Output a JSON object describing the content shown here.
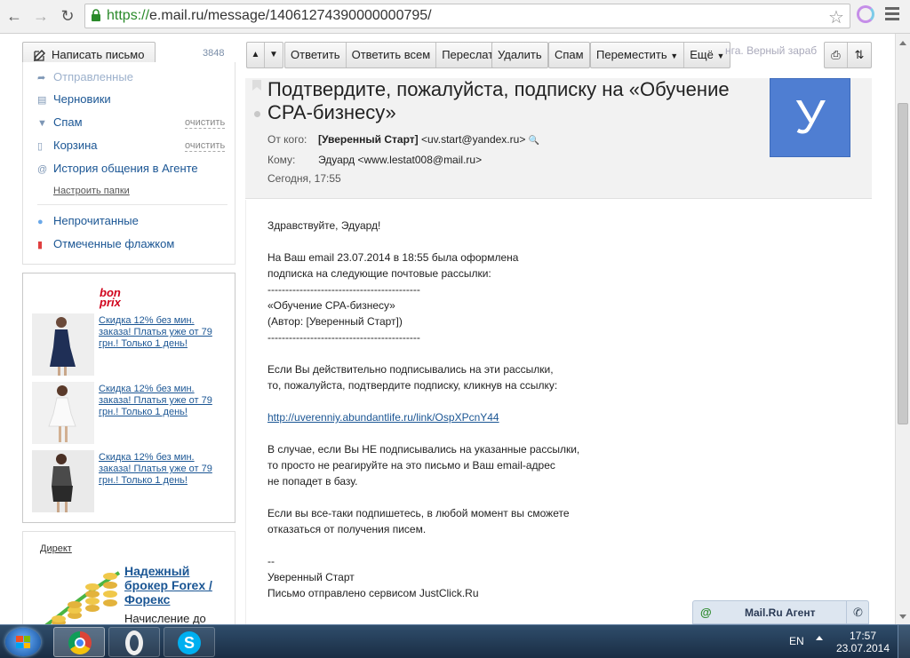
{
  "browser": {
    "url_scheme": "https://",
    "url_rest": "e.mail.ru/message/14061274390000000795/"
  },
  "toolbar": {
    "compose_label": "Написать письмо",
    "counter": "3848",
    "reply": "Ответить",
    "reply_all": "Ответить всем",
    "forward": "Переслать",
    "delete": "Удалить",
    "spam": "Спам",
    "move": "Переместить",
    "more": "Ещё",
    "faded_text": "нга. Верный зараб"
  },
  "sidebar": {
    "sent_partial": "Отправленные",
    "drafts": "Черновики",
    "spam": "Спам",
    "trash": "Корзина",
    "clear": "очистить",
    "agent_history": "История общения в Агенте",
    "setup_folders": "Настроить папки",
    "unread": "Непрочитанные",
    "flagged": "Отмеченные флажком"
  },
  "ad": {
    "brand_line1": "bon",
    "brand_line2": "prix",
    "items": [
      {
        "text": "Скидка 12% без мин. заказа! Платья уже от 79 грн.! Только 1 день!"
      },
      {
        "text": "Скидка 12% без мин. заказа! Платья уже от 79 грн.! Только 1 день!"
      },
      {
        "text": "Скидка 12% без мин. заказа! Платья уже от 79 грн.! Только 1 день!"
      }
    ]
  },
  "direct": {
    "label": "Директ",
    "title": "Надежный брокер Forex / Форекс",
    "text": "Начисление до"
  },
  "message": {
    "subject": "Подтвердите, пожалуйста, подписку на «Обучение CPA-бизнесу»",
    "from_label": "От кого:",
    "from_name": "[Уверенный Старт]",
    "from_email": "<uv.start@yandex.ru>",
    "to_label": "Кому:",
    "to_value": "Эдуард <www.lestat008@mail.ru>",
    "date": "Сегодня, 17:55",
    "avatar_letter": "У",
    "body": {
      "l1": "Здравствуйте, Эдуард!",
      "l2": "На Ваш email 23.07.2014 в 18:55 была оформлена",
      "l3": "подписка на следующие почтовые рассылки:",
      "sep": "-------------------------------------------",
      "l4": "«Обучение CPA-бизнесу»",
      "l5": "(Автор: [Уверенный Старт])",
      "l6": "Если Вы действительно подписывались на эти рассылки,",
      "l7": "то, пожалуйста, подтвердите подписку, кликнув на ссылку:",
      "link": "http://uverenniy.abundantlife.ru/link/OspXPcnY44",
      "l8": "В случае, если Вы НЕ подписывались на указанные рассылки,",
      "l9": "то просто не реагируйте на это письмо и Ваш email-адрес",
      "l10": "не попадет в базу.",
      "l11": "Если вы все-таки подпишетесь, в любой момент вы сможете",
      "l12": "отказаться от получения писем.",
      "l13": "--",
      "l14": "Уверенный Старт",
      "l15": "Письмо отправлено сервисом JustClick.Ru"
    }
  },
  "agent": {
    "label": "Mail.Ru Агент"
  },
  "taskbar": {
    "lang": "EN",
    "time": "17:57",
    "date": "23.07.2014"
  }
}
